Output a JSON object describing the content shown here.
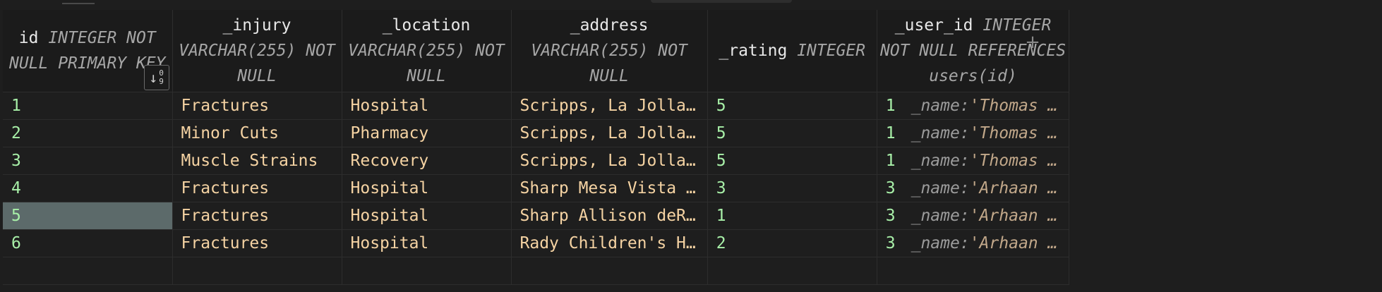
{
  "columns": [
    {
      "name": "id",
      "type": "INTEGER NOT NULL PRIMARY KEY"
    },
    {
      "name": "_injury",
      "type": "VARCHAR(255) NOT NULL"
    },
    {
      "name": "_location",
      "type": "VARCHAR(255) NOT NULL"
    },
    {
      "name": "_address",
      "type": "VARCHAR(255) NOT NULL"
    },
    {
      "name": "_rating",
      "type": "INTEGER"
    },
    {
      "name": "_user_id",
      "type": "INTEGER NOT NULL REFERENCES users(id)"
    }
  ],
  "sort_icon": {
    "arrow": "↓",
    "top_digit": "0",
    "bottom_digit": "9"
  },
  "add_column_label": "+",
  "rows": [
    {
      "id": "1",
      "injury": "Fractures",
      "location": "Hospital",
      "address": "Scripps, La Jolla…",
      "rating": "5",
      "user_id": "1",
      "user_key": "_name:",
      "user_val": "'Thomas …"
    },
    {
      "id": "2",
      "injury": "Minor Cuts",
      "location": "Pharmacy",
      "address": "Scripps, La Jolla…",
      "rating": "5",
      "user_id": "1",
      "user_key": "_name:",
      "user_val": "'Thomas …"
    },
    {
      "id": "3",
      "injury": "Muscle Strains",
      "location": "Recovery",
      "address": "Scripps, La Jolla…",
      "rating": "5",
      "user_id": "1",
      "user_key": "_name:",
      "user_val": "'Thomas …"
    },
    {
      "id": "4",
      "injury": "Fractures",
      "location": "Hospital",
      "address": "Sharp Mesa Vista …",
      "rating": "3",
      "user_id": "3",
      "user_key": "_name:",
      "user_val": "'Arhaan …"
    },
    {
      "id": "5",
      "injury": "Fractures",
      "location": "Hospital",
      "address": "Sharp Allison deR…",
      "rating": "1",
      "user_id": "3",
      "user_key": "_name:",
      "user_val": "'Arhaan …"
    },
    {
      "id": "6",
      "injury": "Fractures",
      "location": "Hospital",
      "address": "Rady Children's H…",
      "rating": "2",
      "user_id": "3",
      "user_key": "_name:",
      "user_val": "'Arhaan …"
    }
  ],
  "selected_row_index": 4
}
